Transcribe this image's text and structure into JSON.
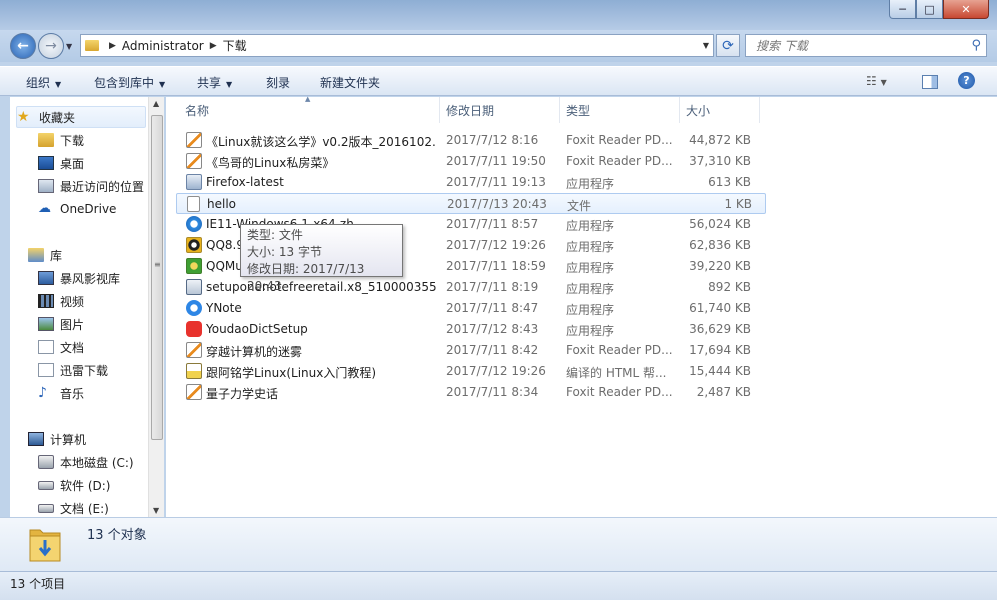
{
  "window": {
    "controls": {
      "minimize": "─",
      "maximize": "□",
      "close": "✕"
    }
  },
  "navigation": {
    "address_crumbs": [
      "Administrator",
      "下载"
    ],
    "search_placeholder": "搜索 下载"
  },
  "toolbar": {
    "organize": "组织",
    "include_in_library": "包含到库中",
    "share": "共享",
    "burn": "刻录",
    "new_folder": "新建文件夹"
  },
  "sidebar": {
    "favorites": {
      "label": "收藏夹",
      "items": [
        "下载",
        "桌面",
        "最近访问的位置",
        "OneDrive"
      ]
    },
    "libraries": {
      "label": "库",
      "items": [
        "暴风影视库",
        "视频",
        "图片",
        "文档",
        "迅雷下载",
        "音乐"
      ]
    },
    "computer": {
      "label": "计算机",
      "items": [
        "本地磁盘 (C:)",
        "软件 (D:)",
        "文档 (E:)"
      ]
    }
  },
  "columns": {
    "name": "名称",
    "date": "修改日期",
    "type": "类型",
    "size": "大小"
  },
  "files": [
    {
      "name": "《Linux就该这么学》v0.2版本_2016102...",
      "date": "2017/7/12 8:16",
      "type": "Foxit Reader PD...",
      "size": "44,872 KB",
      "icon": "pdf-icon"
    },
    {
      "name": "《鸟哥的Linux私房菜》",
      "date": "2017/7/11 19:50",
      "type": "Foxit Reader PD...",
      "size": "37,310 KB",
      "icon": "pdf-icon"
    },
    {
      "name": "Firefox-latest",
      "date": "2017/7/11 19:13",
      "type": "应用程序",
      "size": "613 KB",
      "icon": "firefox-icon"
    },
    {
      "name": "hello",
      "date": "2017/7/13 20:43",
      "type": "文件",
      "size": "1 KB",
      "icon": "file-icon"
    },
    {
      "name": "IE11-Windows6.1-x64-zh",
      "date": "2017/7/11 8:57",
      "type": "应用程序",
      "size": "56,024 KB",
      "icon": "ie-icon"
    },
    {
      "name": "QQ8.9",
      "date": "2017/7/12 19:26",
      "type": "应用程序",
      "size": "62,836 KB",
      "icon": "qq-icon"
    },
    {
      "name": "QQMusic",
      "date": "2017/7/11 18:59",
      "type": "应用程序",
      "size": "39,220 KB",
      "icon": "qqmusic-icon"
    },
    {
      "name": "setuponenotefreeretail.x8_510000355...",
      "date": "2017/7/11 8:19",
      "type": "应用程序",
      "size": "892 KB",
      "icon": "setup-icon"
    },
    {
      "name": "YNote",
      "date": "2017/7/11 8:47",
      "type": "应用程序",
      "size": "61,740 KB",
      "icon": "ynote-icon"
    },
    {
      "name": "YoudaoDictSetup",
      "date": "2017/7/12 8:43",
      "type": "应用程序",
      "size": "36,629 KB",
      "icon": "youdao-icon"
    },
    {
      "name": "穿越计算机的迷雾",
      "date": "2017/7/11 8:42",
      "type": "Foxit Reader PD...",
      "size": "17,694 KB",
      "icon": "pdf-icon"
    },
    {
      "name": "跟阿铭学Linux(Linux入门教程)",
      "date": "2017/7/12 19:26",
      "type": "编译的 HTML 帮...",
      "size": "15,444 KB",
      "icon": "chm-icon"
    },
    {
      "name": "量子力学史话",
      "date": "2017/7/11 8:34",
      "type": "Foxit Reader PD...",
      "size": "2,487 KB",
      "icon": "pdf-icon"
    }
  ],
  "tooltip": {
    "type_line": "类型: 文件",
    "size_line": "大小: 13 字节",
    "date_line": "修改日期: 2017/7/13 20:43"
  },
  "details": {
    "count": "13 个对象"
  },
  "status": {
    "items": "13 个项目"
  }
}
